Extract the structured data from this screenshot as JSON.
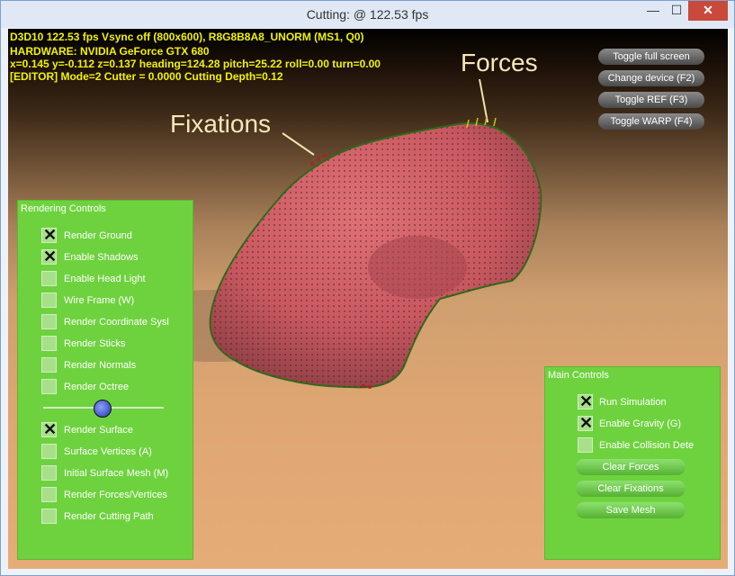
{
  "window": {
    "title": "Cutting: @ 122.53 fps",
    "controls": {
      "minimize": "—",
      "maximize": "☐",
      "close": "✕"
    }
  },
  "hud": {
    "lines": [
      "D3D10 122.53 fps Vsync off (800x600), R8G8B8A8_UNORM (MS1, Q0)",
      "HARDWARE: NVIDIA GeForce GTX 680",
      "x=0.145 y=-0.112 z=0.137 heading=124.28 pitch=25.22 roll=0.00 turn=0.00",
      "[EDITOR] Mode=2 Cutter = 0.0000 Cutting Depth=0.12"
    ]
  },
  "right_buttons": [
    "Toggle full screen",
    "Change device (F2)",
    "Toggle REF (F3)",
    "Toggle WARP (F4)"
  ],
  "annotations": {
    "forces": "Forces",
    "fixations": "Fixations"
  },
  "rendering_controls": {
    "title": "Rendering Controls",
    "items": [
      {
        "label": "Render Ground",
        "checked": true
      },
      {
        "label": "Enable Shadows",
        "checked": true
      },
      {
        "label": "Enable Head Light",
        "checked": false
      },
      {
        "label": "Wire Frame (W)",
        "checked": false
      },
      {
        "label": "Render Coordinate Sysl",
        "checked": false
      },
      {
        "label": "Render Sticks",
        "checked": false
      },
      {
        "label": "Render Normals",
        "checked": false
      },
      {
        "label": "Render Octree",
        "checked": false
      },
      {
        "label": "Render Surface",
        "checked": true
      },
      {
        "label": "Surface Vertices (A)",
        "checked": false
      },
      {
        "label": "Initial Surface Mesh (M)",
        "checked": false
      },
      {
        "label": "Render Forces/Vertices",
        "checked": false
      },
      {
        "label": "Render Cutting Path",
        "checked": false
      }
    ],
    "slider_value": 0.5
  },
  "main_controls": {
    "title": "Main Controls",
    "items": [
      {
        "label": "Run Simulation",
        "checked": true
      },
      {
        "label": "Enable Gravity (G)",
        "checked": true
      },
      {
        "label": "Enable Collision Dete",
        "checked": false
      }
    ],
    "buttons": [
      "Clear Forces",
      "Clear Fixations",
      "Save Mesh"
    ]
  },
  "colors": {
    "hud_text": "#f2f200",
    "panel_green": "#6ed23e",
    "mesh_pink": "#c9575f",
    "annotation_text": "#f7e7b8"
  }
}
